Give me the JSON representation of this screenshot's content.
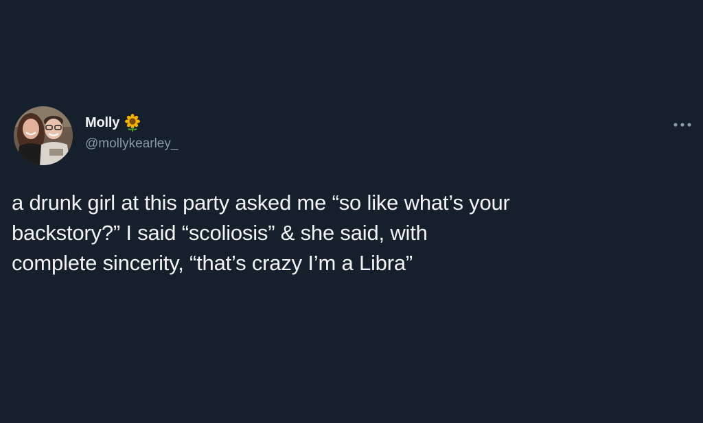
{
  "author": {
    "display_name": "Molly",
    "handle": "@mollykearley_",
    "badge_icon": "sunflower-icon",
    "avatar": "profile-photo"
  },
  "tweet": {
    "text": "a drunk girl at this party asked me “so like what’s your\nbackstory?” I said “scoliosis” & she said, with\ncomplete sincerity, “that’s crazy I’m a Libra”"
  },
  "actions": {
    "more_icon": "more-options-icon"
  },
  "colors": {
    "background": "#16202c",
    "text_primary": "#f2f4f6",
    "text_secondary": "#8b98a5"
  }
}
